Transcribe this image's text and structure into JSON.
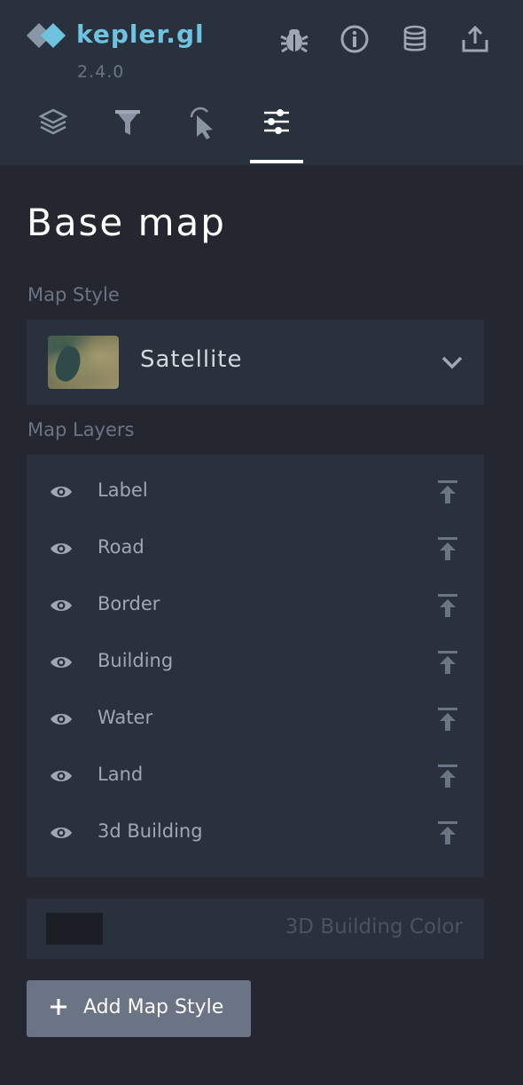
{
  "header": {
    "app_name": "kepler.gl",
    "version": "2.4.0",
    "actions": [
      {
        "name": "bug-report",
        "icon": "bug-icon"
      },
      {
        "name": "info",
        "icon": "info-icon"
      },
      {
        "name": "data",
        "icon": "database-icon"
      },
      {
        "name": "export",
        "icon": "share-icon"
      }
    ],
    "tabs": [
      {
        "name": "layers",
        "icon": "layers-icon",
        "active": false
      },
      {
        "name": "filters",
        "icon": "filter-icon",
        "active": false
      },
      {
        "name": "interactions",
        "icon": "cursor-icon",
        "active": false
      },
      {
        "name": "base-map",
        "icon": "sliders-icon",
        "active": true
      }
    ]
  },
  "panel": {
    "title": "Base map",
    "map_style_label": "Map Style",
    "selected_style": "Satellite",
    "map_layers_label": "Map Layers",
    "layers": [
      {
        "label": "Label"
      },
      {
        "label": "Road"
      },
      {
        "label": "Border"
      },
      {
        "label": "Building"
      },
      {
        "label": "Water"
      },
      {
        "label": "Land"
      },
      {
        "label": "3d Building"
      }
    ],
    "building_color_label": "3D Building Color",
    "building_color": "#1b1e25",
    "add_button_label": "Add Map Style"
  },
  "colors": {
    "accent": "#6fc3e0",
    "header_bg": "#29323c",
    "panel_bg": "#242730",
    "button_bg": "#6a7485"
  }
}
